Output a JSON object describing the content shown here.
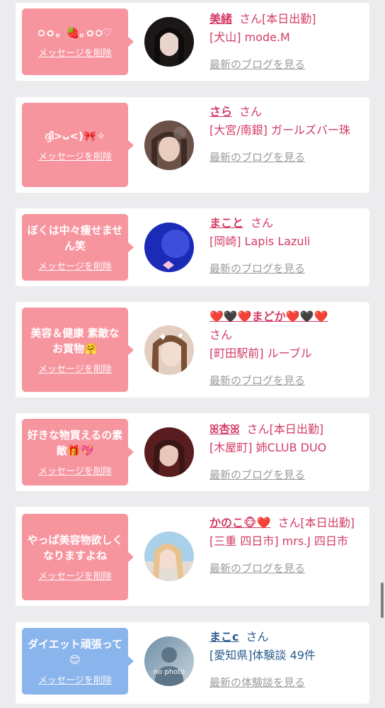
{
  "delete_label": "メッセージを削除",
  "san_label": "さん",
  "cards": [
    {
      "message": "੦ｏ。🍓｡ｏ੦♡",
      "name": "美緒",
      "badge": "[本日出勤]",
      "shop": "[犬山] mode.M",
      "blog": "最新のブログを見る"
    },
    {
      "message": "ദ്ദി>ᴗ<)🎀✧",
      "name": "さら",
      "badge": "",
      "shop": "[大宮/南銀] ガールズバー珠",
      "blog": "最新のブログを見る"
    },
    {
      "message": "ぼくは中々痩せません笑",
      "name": "まこと",
      "badge": "",
      "shop": "[岡崎] Lapis Lazuli",
      "blog": "最新のブログを見る"
    },
    {
      "message": "美容＆健康 素敵なお買物🤗",
      "name": "❤️🖤❤️まどか❤️🖤❤️",
      "badge": "",
      "shop": "[町田駅前] ルーブル",
      "blog": "最新のブログを見る"
    },
    {
      "message": "好きな物買えるの素敵🎁💖",
      "name": "ꕤ杏ꕤ",
      "badge": "[本日出勤]",
      "shop": "[木屋町] 姉CLUB DUO",
      "blog": "最新のブログを見る"
    },
    {
      "message": "やっぱ美容物欲しくなりますよね",
      "name": "かのこ🐵❤️",
      "badge": "[本日出勤]",
      "shop": "[三重 四日市] mrs.J 四日市",
      "blog": "最新のブログを見る"
    },
    {
      "message": "ダイエット頑張って😊",
      "name": "まこc",
      "badge": "",
      "shop": "[愛知県]体験談 49件",
      "blog": "最新の体験談を見る"
    }
  ],
  "no_photo_label": "no photo",
  "colors": {
    "pink_bubble": "#f7959f",
    "blue_bubble": "#8ab4ec",
    "name_pink": "#d33c66",
    "name_blue": "#2a5b8e",
    "link_gray": "#9b9b9b"
  }
}
